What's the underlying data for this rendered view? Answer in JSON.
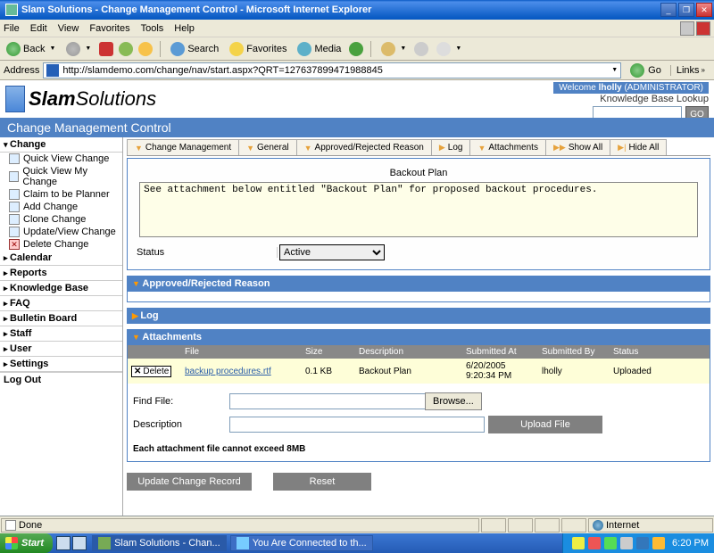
{
  "window": {
    "title": "Slam Solutions - Change Management Control - Microsoft Internet Explorer"
  },
  "menu": {
    "items": [
      "File",
      "Edit",
      "View",
      "Favorites",
      "Tools",
      "Help"
    ]
  },
  "toolbar": {
    "back": "Back",
    "search": "Search",
    "favorites": "Favorites",
    "media": "Media"
  },
  "address": {
    "label": "Address",
    "url": "http://slamdemo.com/change/nav/start.aspx?QRT=127637899471988845",
    "go": "Go",
    "links": "Links"
  },
  "banner": {
    "logo_bold": "Slam",
    "logo_light": "Solutions",
    "welcome_prefix": "Welcome ",
    "welcome_user": "lholly",
    "welcome_role": " (ADMINISTRATOR)",
    "kb_label": "Knowledge Base Lookup",
    "go": "GO"
  },
  "bluebar": {
    "title": "Change Management Control"
  },
  "sidebar": {
    "change": {
      "head": "Change",
      "items": [
        "Quick View Change",
        "Quick View My Change",
        "Claim to be Planner",
        "Add Change",
        "Clone Change",
        "Update/View Change",
        "Delete Change"
      ]
    },
    "sections": [
      "Calendar",
      "Reports",
      "Knowledge Base",
      "FAQ",
      "Bulletin Board",
      "Staff",
      "User",
      "Settings"
    ],
    "logout": "Log Out"
  },
  "tabs": [
    "Change Management",
    "General",
    "Approved/Rejected Reason",
    "Log",
    "Attachments",
    "Show All",
    "Hide All"
  ],
  "backout": {
    "title": "Backout Plan",
    "text": "See attachment below entitled \"Backout Plan\" for proposed backout procedures.",
    "status_label": "Status",
    "status_value": "Active"
  },
  "sections": {
    "approved_head": "Approved/Rejected Reason",
    "log_head": "Log",
    "attachments_head": "Attachments"
  },
  "att_table": {
    "headers": [
      "",
      "File",
      "Size",
      "Description",
      "Submitted At",
      "Submitted By",
      "Status"
    ],
    "row": {
      "del": "Delete",
      "file": "backup procedures.rtf",
      "size": "0.1 KB",
      "desc": "Backout Plan",
      "at_date": "6/20/2005",
      "at_time": "9:20:34 PM",
      "by": "lholly",
      "status": "Uploaded"
    }
  },
  "upload": {
    "find_label": "Find File:",
    "desc_label": "Description",
    "browse": "Browse...",
    "upload_btn": "Upload File",
    "note": "Each attachment file cannot exceed 8MB"
  },
  "buttons": {
    "update": "Update Change Record",
    "reset": "Reset"
  },
  "ie_status": {
    "done": "Done",
    "zone": "Internet"
  },
  "taskbar": {
    "start": "Start",
    "task1": "Slam Solutions - Chan...",
    "task2": "You Are Connected to th...",
    "clock": "6:20 PM"
  }
}
